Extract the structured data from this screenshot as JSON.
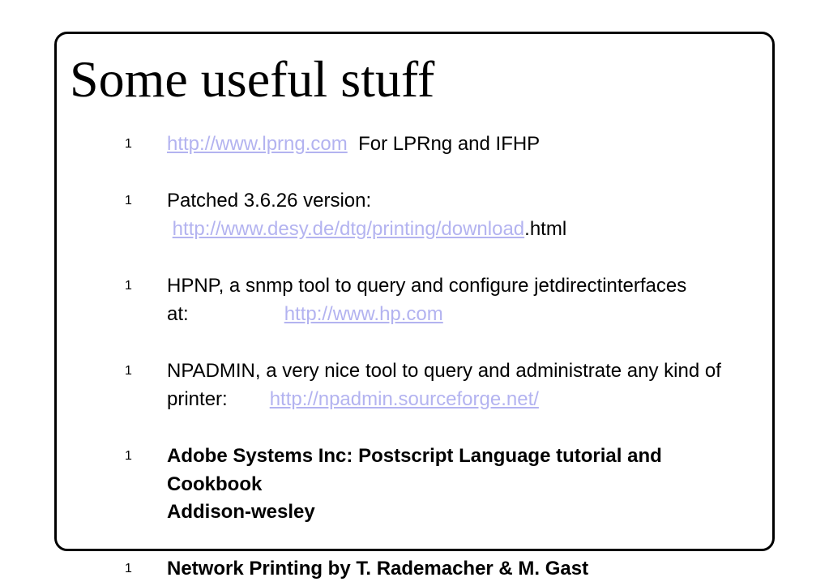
{
  "slide": {
    "title": "Some useful stuff",
    "bullet_marker": "1",
    "items": [
      {
        "link": "http://www.lprng.com",
        "text": "For LPRng and IFHP"
      },
      {
        "line1": "Patched 3.6.26 version:",
        "link": "http://www.desy.de/dtg/printing/download",
        "suffix": ".html"
      },
      {
        "line1": "HPNP, a snmp tool to query and configure jetdirectinterfaces",
        "line2_label": "at:",
        "link": "http://www.hp.com"
      },
      {
        "line1": "NPADMIN, a very nice tool to query and administrate any kind of",
        "line2_label": "printer:",
        "link": "http://npadmin.sourceforge.net/"
      },
      {
        "line1": "Adobe Systems Inc: Postscript Language tutorial and",
        "line2": "Cookbook",
        "line3": "Addison-wesley"
      },
      {
        "line1": "Network Printing by T. Rademacher & M. Gast"
      }
    ]
  },
  "colors": {
    "link": "#b3b3f0",
    "text": "#000000",
    "frame": "#000000"
  }
}
